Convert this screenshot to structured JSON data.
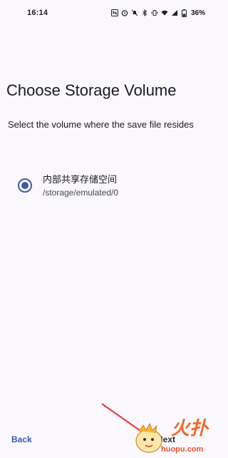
{
  "status_bar": {
    "time": "16:14",
    "battery_percent": "36%",
    "icons": [
      "nfc-icon",
      "alarm-icon",
      "mute-icon",
      "bluetooth-icon",
      "vibrate-icon",
      "wifi-icon",
      "signal-icon",
      "battery-icon"
    ]
  },
  "page": {
    "title": "Choose Storage Volume",
    "subtitle": "Select the volume where the save file resides"
  },
  "volumes": [
    {
      "name": "内部共享存储空间",
      "path": "/storage/emulated/0",
      "selected": true
    }
  ],
  "buttons": {
    "back_label": "Back",
    "next_label": "Next"
  },
  "watermark": {
    "text": "huopu.com"
  },
  "colors": {
    "background": "#fbf8fd",
    "accent": "#3d5ba9",
    "text_primary": "#1b1b1f",
    "annotation_arrow": "#e53935"
  }
}
